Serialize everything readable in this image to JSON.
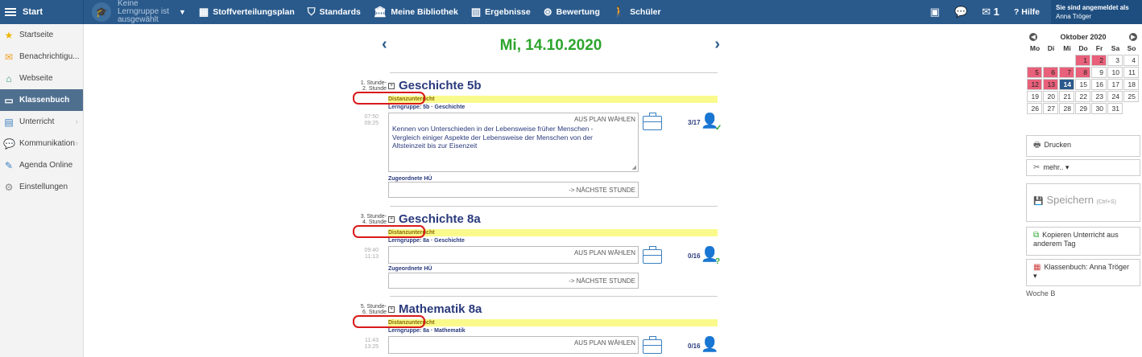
{
  "topbar": {
    "start": "Start",
    "lerngruppe": "Keine Lerngruppe ist ausgewählt",
    "nav": [
      {
        "label": "Stoffverteilungsplan",
        "icon": "grid-icon"
      },
      {
        "label": "Standards",
        "icon": "shield-icon"
      },
      {
        "label": "Meine Bibliothek",
        "icon": "library-icon"
      },
      {
        "label": "Ergebnisse",
        "icon": "bar-chart-icon"
      },
      {
        "label": "Bewertung",
        "icon": "grade-icon"
      },
      {
        "label": "Schüler",
        "icon": "students-icon"
      }
    ],
    "mail_count": "1",
    "help": "Hilfe",
    "login_label": "Sie sind angemeldet als",
    "login_user": "Anna Tröger"
  },
  "sidebar": {
    "items": [
      {
        "label": "Startseite"
      },
      {
        "label": "Benachrichtigu..."
      },
      {
        "label": "Webseite"
      },
      {
        "label": "Klassenbuch"
      },
      {
        "label": "Unterricht"
      },
      {
        "label": "Kommunikation"
      },
      {
        "label": "Agenda Online"
      },
      {
        "label": "Einstellungen"
      }
    ]
  },
  "main": {
    "date": "Mi, 14.10.2020",
    "lessons": [
      {
        "stunde": "1. Stunde-\n2. Stunde",
        "subject": "Geschichte  5b",
        "distanz": "Distanzunterricht",
        "lerngruppe": "Lerngruppe:  5b · Geschichte",
        "time": "07:50\n09:25",
        "plan": "AUS PLAN WÄHLEN",
        "content": "Kennen von Unterschieden in der Lebensweise früher Menschen - Vergleich einiger Aspekte der Lebensweise der Menschen von der Altsteinzeit bis zur Eisenzeit",
        "hu_label": "Zugeordnete HÜ",
        "hu": "-> NÄCHSTE STUNDE",
        "count": "3/17"
      },
      {
        "stunde": "3. Stunde-\n4. Stunde",
        "subject": "Geschichte  8a",
        "distanz": "Distanzunterricht",
        "lerngruppe": "Lerngruppe:  8a · Geschichte",
        "time": "09:40\n11:13",
        "plan": "AUS PLAN WÄHLEN",
        "hu_label": "Zugeordnete HÜ",
        "hu": "-> NÄCHSTE STUNDE",
        "count": "0/16"
      },
      {
        "stunde": "5. Stunde-\n6. Stunde",
        "subject": "Mathematik  8a",
        "distanz": "Distanzunterricht",
        "lerngruppe": "Lerngruppe:  8a · Mathematik",
        "time": "11:43\n13:25",
        "plan": "AUS PLAN WÄHLEN",
        "count": "0/16"
      }
    ]
  },
  "calendar": {
    "month": "Oktober 2020",
    "days_header": [
      "Mo",
      "Di",
      "Mi",
      "Do",
      "Fr",
      "Sa",
      "So"
    ]
  },
  "right": {
    "print": "Drucken",
    "more": "mehr.. ▾",
    "save": "Speichern",
    "save_hint": "(Ctrl+S)",
    "copy": "Kopieren Unterricht aus anderem Tag",
    "classbook": "Klassenbuch: Anna Tröger ▾",
    "woche": "Woche B"
  },
  "colors": {
    "topbar": "#2a5a8c",
    "date_green": "#2da52d",
    "highlight_yellow": "#fafa8c",
    "annotation_red": "#d81a1a",
    "calendar_red": "#e8607a"
  }
}
